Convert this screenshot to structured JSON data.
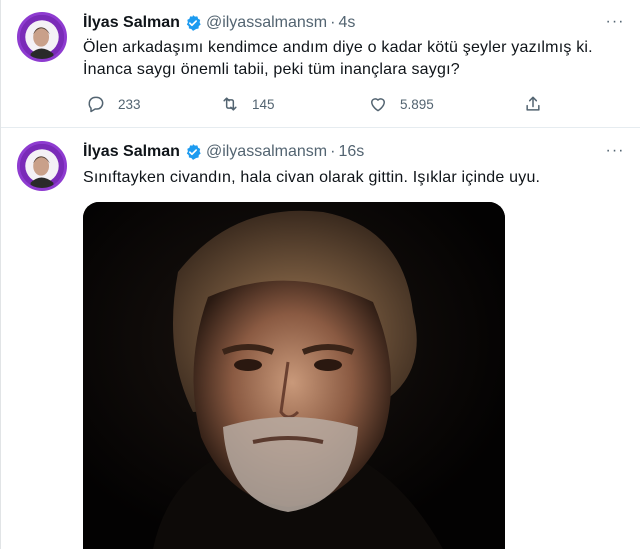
{
  "tweets": [
    {
      "author": "İlyas Salman",
      "handle": "@ilyassalmansm",
      "time": "4s",
      "text_line1": "Ölen arkadaşımı kendimce andım diye o kadar kötü şeyler yazılmış ki.",
      "text_line2": "İnanca saygı önemli tabii, peki tüm inançlara saygı?",
      "replies": "233",
      "retweets": "145",
      "likes": "5.895"
    },
    {
      "author": "İlyas Salman",
      "handle": "@ilyassalmansm",
      "time": "16s",
      "text_line1": "Sınıftayken civandın, hala civan olarak gittin. Işıklar içinde uyu."
    }
  ],
  "dot": "·",
  "more_glyph": "···",
  "colors": {
    "verified": "#1d9bf0",
    "secondary_text": "#536471",
    "avatar_ring": "#8e3bd0"
  },
  "icons": {
    "reply": "reply-icon",
    "retweet": "retweet-icon",
    "like": "like-icon",
    "share": "share-icon",
    "verified": "verified-badge-icon"
  }
}
